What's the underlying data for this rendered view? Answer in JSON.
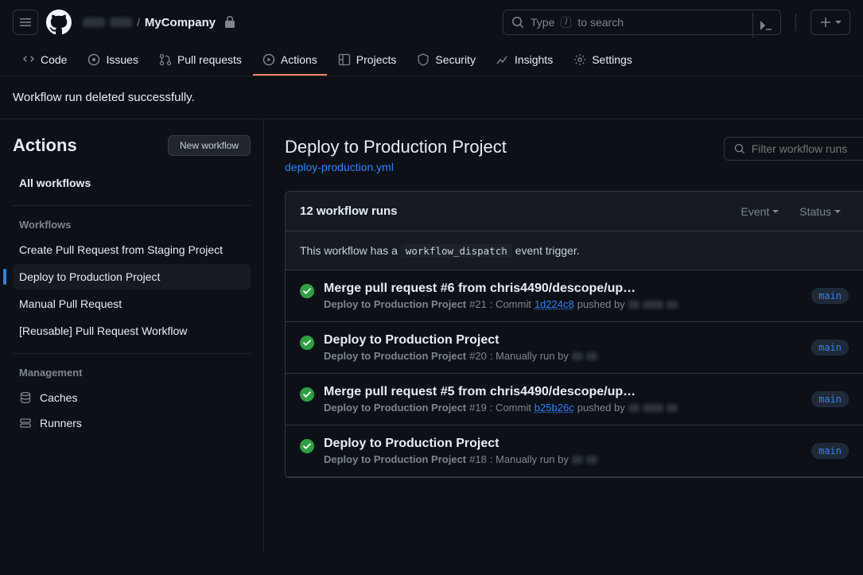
{
  "header": {
    "repo_name": "MyCompany",
    "search_prefix": "Type",
    "search_kbd": "/",
    "search_suffix": "to search"
  },
  "nav": {
    "code": "Code",
    "issues": "Issues",
    "pulls": "Pull requests",
    "actions": "Actions",
    "projects": "Projects",
    "security": "Security",
    "insights": "Insights",
    "settings": "Settings"
  },
  "banner": "Workflow run deleted successfully.",
  "sidebar": {
    "title": "Actions",
    "new_workflow": "New workflow",
    "all": "All workflows",
    "wf_label": "Workflows",
    "items": [
      "Create Pull Request from Staging Project",
      "Deploy to Production Project",
      "Manual Pull Request",
      "[Reusable] Pull Request Workflow"
    ],
    "mgmt_label": "Management",
    "caches": "Caches",
    "runners": "Runners"
  },
  "main": {
    "title": "Deploy to Production Project",
    "file": "deploy-production.yml",
    "filter_placeholder": "Filter workflow runs",
    "runs_count": "12 workflow runs",
    "event_label": "Event",
    "status_label": "Status",
    "trigger_pre": "This workflow has a ",
    "trigger_code": "workflow_dispatch",
    "trigger_post": " event trigger.",
    "runs": [
      {
        "title": "Merge pull request #6 from chris4490/descope/up…",
        "wf": "Deploy to Production Project",
        "num": "#21",
        "meta_type": "commit",
        "sha": "1d224c8",
        "branch": "main"
      },
      {
        "title": "Deploy to Production Project",
        "wf": "Deploy to Production Project",
        "num": "#20",
        "meta_type": "manual",
        "branch": "main"
      },
      {
        "title": "Merge pull request #5 from chris4490/descope/up…",
        "wf": "Deploy to Production Project",
        "num": "#19",
        "meta_type": "commit",
        "sha": "b25b26c",
        "branch": "main"
      },
      {
        "title": "Deploy to Production Project",
        "wf": "Deploy to Production Project",
        "num": "#18",
        "meta_type": "manual",
        "branch": "main"
      }
    ],
    "meta_text": {
      "commit_colon": ": Commit ",
      "pushed_by": " pushed by",
      "manual": ": Manually run by"
    }
  }
}
